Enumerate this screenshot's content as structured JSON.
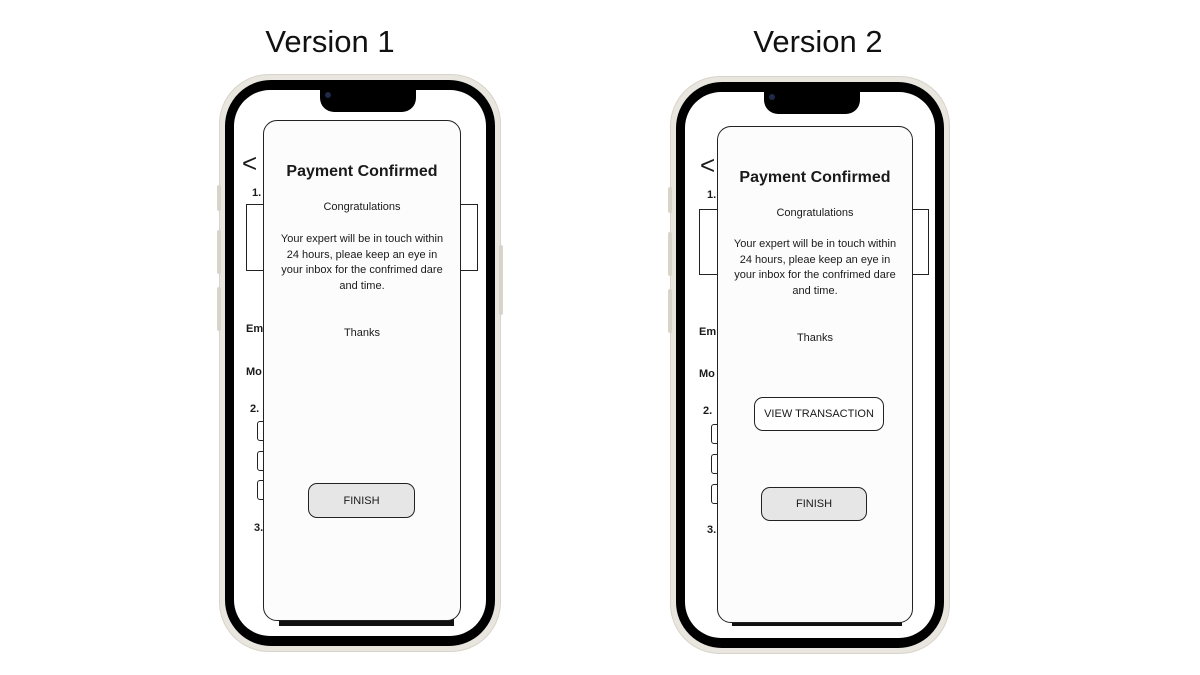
{
  "versions": [
    {
      "label": "Version 1",
      "background": {
        "back": "<",
        "step1": "1.",
        "email": "Em",
        "mobile": "Mo",
        "step2": "2.",
        "step3": "3."
      },
      "modal": {
        "title": "Payment Confirmed",
        "subtitle": "Congratulations",
        "body": "Your expert will be in touch within 24 hours, pleae  keep an eye in your inbox for the confrimed dare and time.",
        "thanks": "Thanks",
        "finish": "FINISH"
      }
    },
    {
      "label": "Version 2",
      "background": {
        "back": "<",
        "step1": "1.",
        "email": "Em",
        "mobile": "Mo",
        "step2": "2.",
        "step3": "3."
      },
      "modal": {
        "title": "Payment Confirmed",
        "subtitle": "Congratulations",
        "body": "Your expert will be in touch within 24 hours, pleae  keep an eye in your inbox for the confrimed dare and time.",
        "thanks": "Thanks",
        "view_transaction": "VIEW TRANSACTION",
        "finish": "FINISH"
      }
    }
  ]
}
